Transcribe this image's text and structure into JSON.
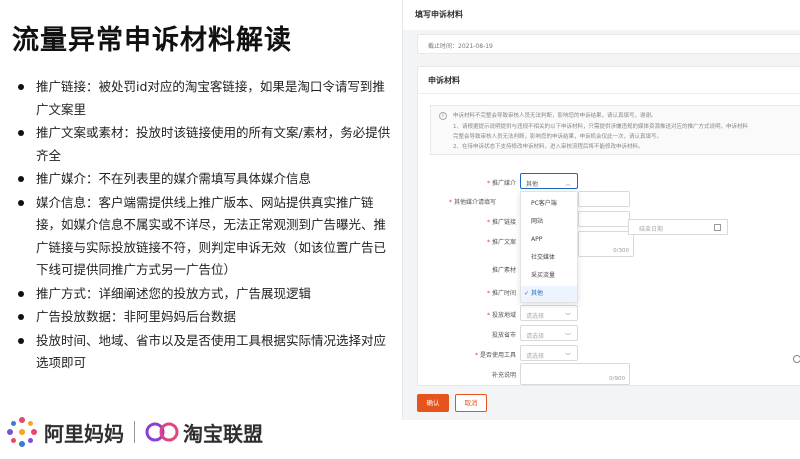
{
  "slide": {
    "title": "流量异常申诉材料解读",
    "bullets": [
      "推广链接：被处罚id对应的淘宝客链接，如果是淘口令请写到推广文案里",
      "推广文案或素材：投放时该链接使用的所有文案/素材，务必提供齐全",
      "推广媒介：不在列表里的媒介需填写具体媒介信息",
      "媒介信息：客户端需提供线上推广版本、网站提供真实推广链接，如媒介信息不属实或不详尽，无法正常观测到广告曝光、推广链接与实际投放链接不符，则判定申诉无效（如该位置广告已下线可提供同推广方式另一广告位）",
      "推广方式：详细阐述您的投放方式，广告展现逻辑",
      "广告投放数据：非阿里妈妈后台数据",
      "投放时间、地域、省市以及是否使用工具根据实际情况选择对应选项即可"
    ],
    "logo_alimama": "阿里妈妈",
    "logo_taobao": "淘宝联盟"
  },
  "form": {
    "header_title": "填写申诉材料",
    "deadline": "截止时间：2021-08-19",
    "section_title": "申诉材料",
    "notice_lines": [
      "申诉材料不完整会导致审核人员无法判断，影响您的申诉结果，请认真填写，谢谢。",
      "1、请根据提示说明提供与违规不相关的以下申诉材料，只需提供涉嫌违规的媒体资源推送对应的推广方式说明，申诉材料",
      "完整会导致审核人员无法判断，影响您的申诉结果，申诉机会仅此一次，请认真填写。",
      "2、在待申诉状态下支持修改申诉材料，进入审核流程后将不能修改申诉材料。"
    ],
    "fields": {
      "media_label": "推广媒介",
      "media_value": "其他",
      "other_media_label": "其他媒介请填写",
      "link_label": "推广链接",
      "copy_label": "推广文案",
      "copy_count": "0/300",
      "material_label": "推广素材",
      "time_label": "推广时间",
      "region_label": "投放地域",
      "region_placeholder": "请选择",
      "province_label": "投放省市",
      "province_placeholder": "请选择",
      "tool_label": "是否使用工具",
      "tool_placeholder": "请选择",
      "extra_label": "补充说明",
      "extra_count": "0/900",
      "end_date_placeholder": "结束日期"
    },
    "dropdown_options": [
      "PC客户端",
      "网站",
      "APP",
      "社交媒体",
      "采买流量",
      "其他"
    ],
    "dropdown_selected": "其他",
    "confirm_label": "确认",
    "cancel_label": "取消"
  },
  "colors": {
    "accent": "#e4541b",
    "link_blue": "#1f67c6",
    "required": "#e4393c"
  }
}
